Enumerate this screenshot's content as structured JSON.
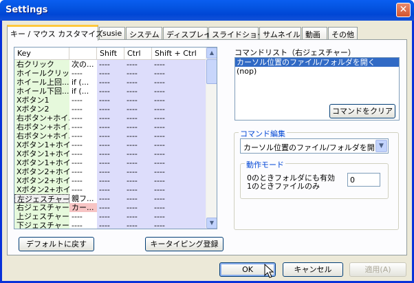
{
  "window": {
    "title": "Settings",
    "close_label": "✕"
  },
  "tabs": [
    {
      "label": "キー / マウス カスタマイズ",
      "active": true
    },
    {
      "label": "susie"
    },
    {
      "label": "システム"
    },
    {
      "label": "ディスプレイ"
    },
    {
      "label": "スライドショー"
    },
    {
      "label": "サムネイル"
    },
    {
      "label": "動画"
    },
    {
      "label": "その他"
    }
  ],
  "grid": {
    "headers": [
      "Key",
      "",
      "Shift",
      "Ctrl",
      "Shift + Ctrl"
    ],
    "rows": [
      [
        "右クリック",
        "次の...",
        "----",
        "----",
        "----"
      ],
      [
        "ホイールクリック",
        "----",
        "----",
        "----",
        "----"
      ],
      [
        "ホイール上回...",
        "if (...",
        "----",
        "----",
        "----"
      ],
      [
        "ホイール下回...",
        "if (...",
        "----",
        "----",
        "----"
      ],
      [
        "Xボタン1",
        "----",
        "----",
        "----",
        "----"
      ],
      [
        "Xボタン2",
        "----",
        "----",
        "----",
        "----"
      ],
      [
        "右ボタン+ホイ...",
        "----",
        "----",
        "----",
        "----"
      ],
      [
        "右ボタン+ホイ...",
        "----",
        "----",
        "----",
        "----"
      ],
      [
        "右ボタン+ホイ...",
        "----",
        "----",
        "----",
        "----"
      ],
      [
        "Xボタン1+ホイ...",
        "----",
        "----",
        "----",
        "----"
      ],
      [
        "Xボタン1+ホイ...",
        "----",
        "----",
        "----",
        "----"
      ],
      [
        "Xボタン1+ホイ...",
        "----",
        "----",
        "----",
        "----"
      ],
      [
        "Xボタン2+ホイ...",
        "----",
        "----",
        "----",
        "----"
      ],
      [
        "Xボタン2+ホイ...",
        "----",
        "----",
        "----",
        "----"
      ],
      [
        "Xボタン2+ホイ...",
        "----",
        "----",
        "----",
        "----"
      ],
      [
        "左ジェスチャー",
        "親フ...",
        "----",
        "----",
        "----"
      ],
      [
        "右ジェスチャー",
        "カー...",
        "----",
        "----",
        "----"
      ],
      [
        "上ジェスチャー",
        "----",
        "----",
        "----",
        "----"
      ],
      [
        "下ジェスチャー",
        "----",
        "----",
        "----",
        "----"
      ]
    ],
    "scroll_up": "▲",
    "scroll_down": "▼"
  },
  "buttons": {
    "reset_default": "デフォルトに戻す",
    "key_typing": "キータイピング登録",
    "clear_command": "コマンドをクリア",
    "ok": "OK",
    "cancel": "キャンセル",
    "apply": "適用(A)"
  },
  "command_list": {
    "label": "コマンドリスト（右ジェスチャー）",
    "items": [
      "カーソル位置のファイル/フォルダを開く",
      "(nop)"
    ]
  },
  "command_edit": {
    "title": "コマンド編集",
    "selected": "カーソル位置のファイル/フォルダを開く",
    "arrow": "▼",
    "mode_title": "動作モード",
    "mode_line1": "0のときフォルダにも有効",
    "mode_line2": "1のときファイルのみ",
    "mode_value": "0"
  }
}
